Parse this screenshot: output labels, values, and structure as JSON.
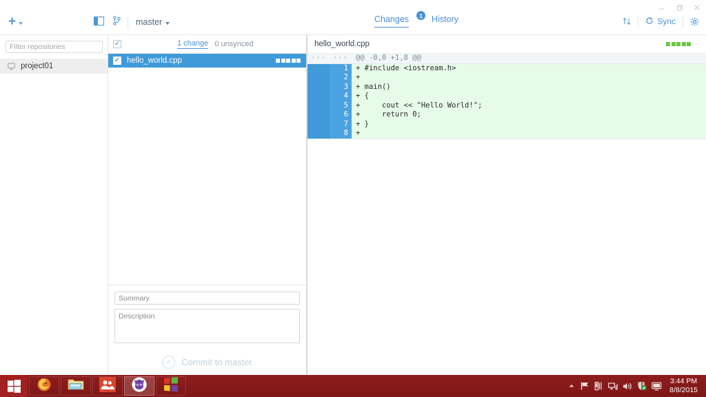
{
  "window": {
    "controls": {
      "minimize": "—",
      "restore": "❐",
      "close": "✕"
    }
  },
  "toolbar": {
    "add_repo_label": "+",
    "panel_toggle_name": "panel-toggle-icon",
    "branch_name": "master",
    "tabs": [
      {
        "label": "Changes",
        "badge": "1",
        "active": true
      },
      {
        "label": "History",
        "badge": "",
        "active": false
      }
    ],
    "sync_label": "Sync",
    "compare_icon": "branch-compare-icon",
    "settings_icon": "gear-icon"
  },
  "sidebar": {
    "filter_placeholder": "Filter repositories",
    "repositories": [
      {
        "name": "project01",
        "selected": true
      }
    ]
  },
  "changes": {
    "select_all_checked": true,
    "changes_count_label": "1 change",
    "unsynced_label": "0 unsynced",
    "files": [
      {
        "name": "hello_world.cpp",
        "checked": true,
        "selected": true,
        "blocks": 5
      }
    ],
    "commit": {
      "summary_placeholder": "Summary",
      "summary_value": "",
      "description_placeholder": "Description",
      "description_value": "",
      "button_label": "Commit to master",
      "enabled": false
    }
  },
  "diff": {
    "file_name": "hello_world.cpp",
    "added_blocks": 5,
    "lines": [
      {
        "old": "···",
        "new": "···",
        "marker": "",
        "text": "@@ -0,0 +1,8 @@",
        "type": "hunk"
      },
      {
        "old": "",
        "new": "1",
        "marker": "+",
        "text": "#include <iostream.h>",
        "type": "add"
      },
      {
        "old": "",
        "new": "2",
        "marker": "+",
        "text": "",
        "type": "add"
      },
      {
        "old": "",
        "new": "3",
        "marker": "+",
        "text": "main()",
        "type": "add"
      },
      {
        "old": "",
        "new": "4",
        "marker": "+",
        "text": "{",
        "type": "add"
      },
      {
        "old": "",
        "new": "5",
        "marker": "+",
        "text": "    cout << \"Hello World!\";",
        "type": "add"
      },
      {
        "old": "",
        "new": "6",
        "marker": "+",
        "text": "    return 0;",
        "type": "add"
      },
      {
        "old": "",
        "new": "7",
        "marker": "+",
        "text": "}",
        "type": "add"
      },
      {
        "old": "",
        "new": "8",
        "marker": "+",
        "text": "",
        "type": "add"
      }
    ]
  },
  "taskbar": {
    "start_icon": "windows-start-icon",
    "items": [
      {
        "icon": "firefox-icon",
        "active": false
      },
      {
        "icon": "file-explorer-icon",
        "active": false
      },
      {
        "icon": "people-icon",
        "active": false
      },
      {
        "icon": "github-desktop-icon",
        "active": true
      },
      {
        "icon": "windows-store-icon",
        "active": false
      }
    ],
    "tray_icons": [
      "show-hidden-icons-icon",
      "flag-action-center-icon",
      "device-icon",
      "network-icon",
      "volume-icon",
      "security-shield-icon",
      "display-icon"
    ],
    "time": "3:44 PM",
    "date": "8/8/2015"
  },
  "colors": {
    "accent_blue": "#4a90d9",
    "selection_blue": "#3f9ada",
    "diff_add_green": "#e7fbe9",
    "block_green": "#6cc644",
    "taskbar_red": "#8d1b1b"
  }
}
